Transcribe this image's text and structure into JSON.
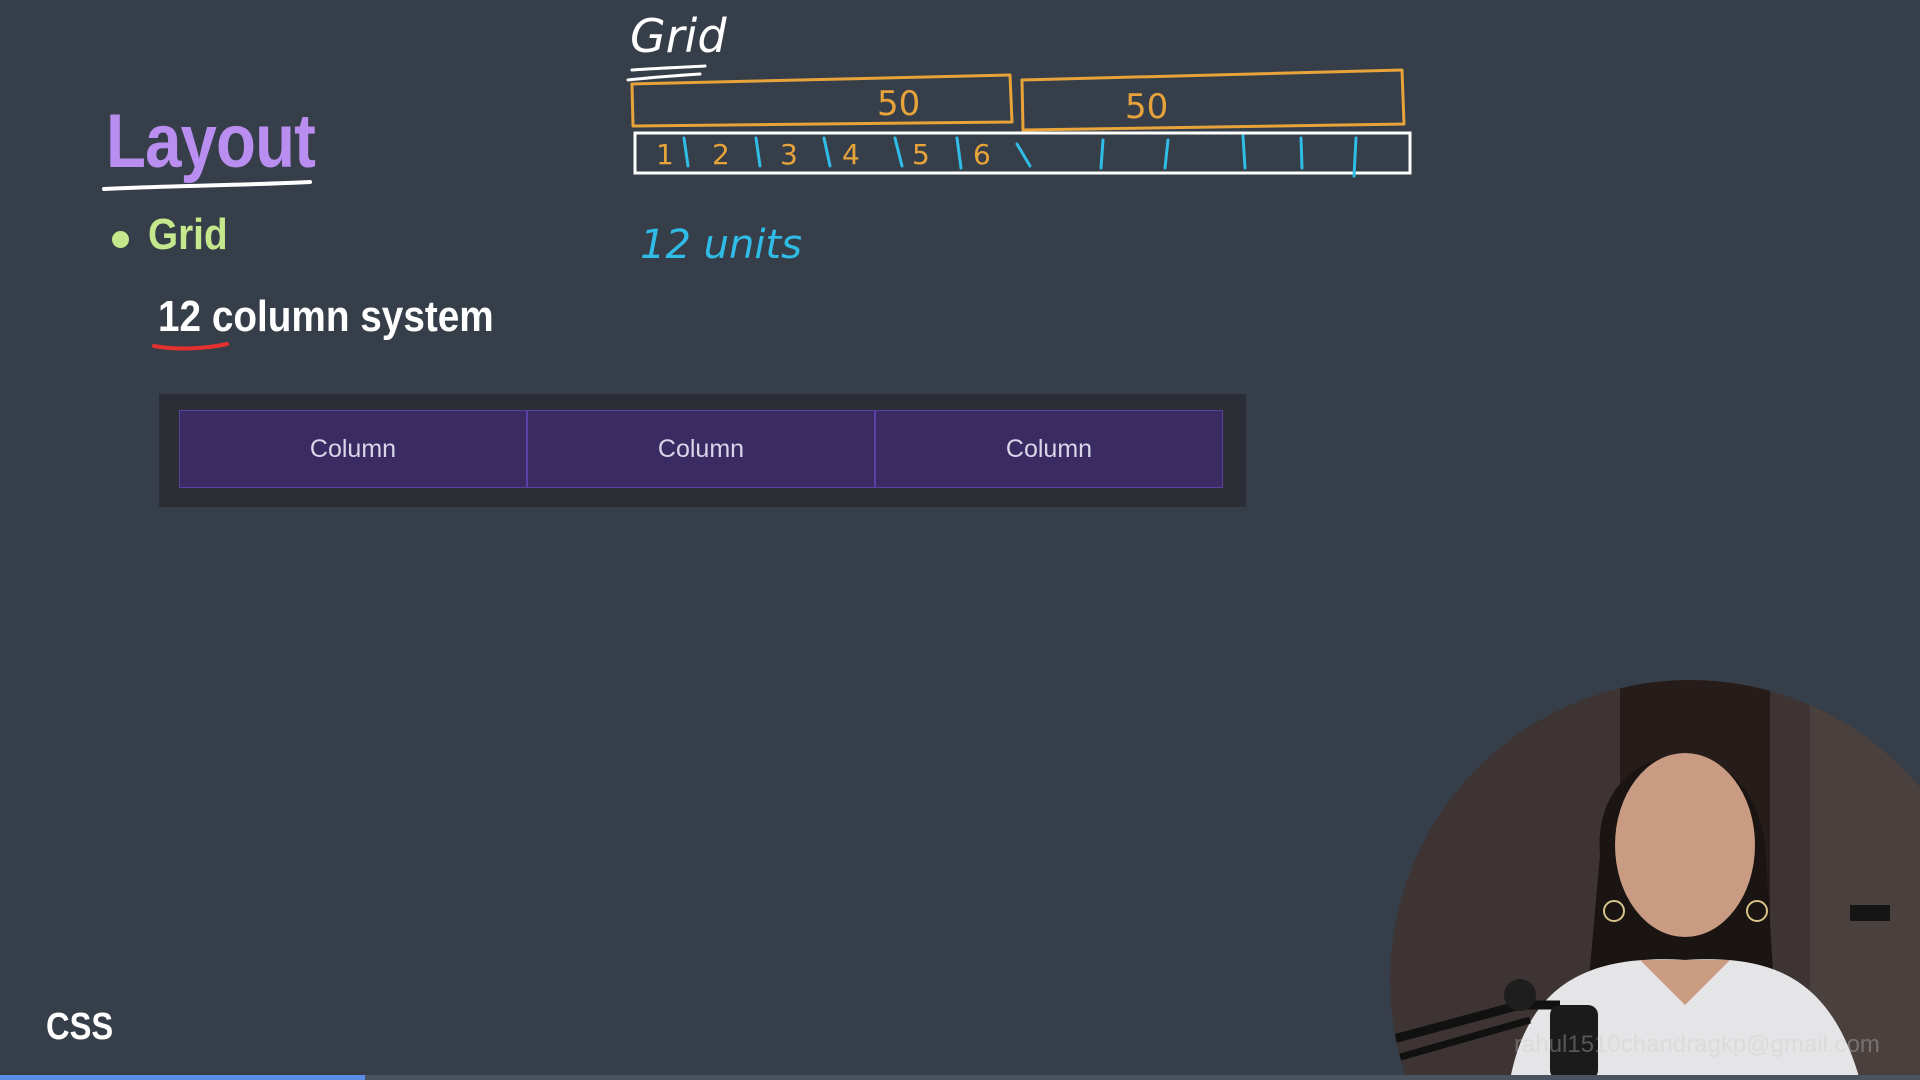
{
  "slide": {
    "title": "Layout",
    "bullet": "Grid",
    "subtitle": "12 column system",
    "course_label": "CSS"
  },
  "demo": {
    "columns": [
      "Column",
      "Column",
      "Column"
    ]
  },
  "annotations": {
    "heading": "Grid",
    "halves": [
      "50",
      "50"
    ],
    "units_numbers": [
      "1",
      "2",
      "3",
      "4",
      "5",
      "6"
    ],
    "units_label": "12 units"
  },
  "webcam": {
    "watermark": "rahul1510chandragkp@gmail.com"
  },
  "progress": {
    "fraction": 0.19
  },
  "colors": {
    "background": "#363f49",
    "title": "#b98ef0",
    "bullet": "#c6e88c",
    "pen_orange": "#e8a33a",
    "pen_cyan": "#2fbde8",
    "pen_red": "#e53030",
    "column_fill": "#3a2b63"
  }
}
